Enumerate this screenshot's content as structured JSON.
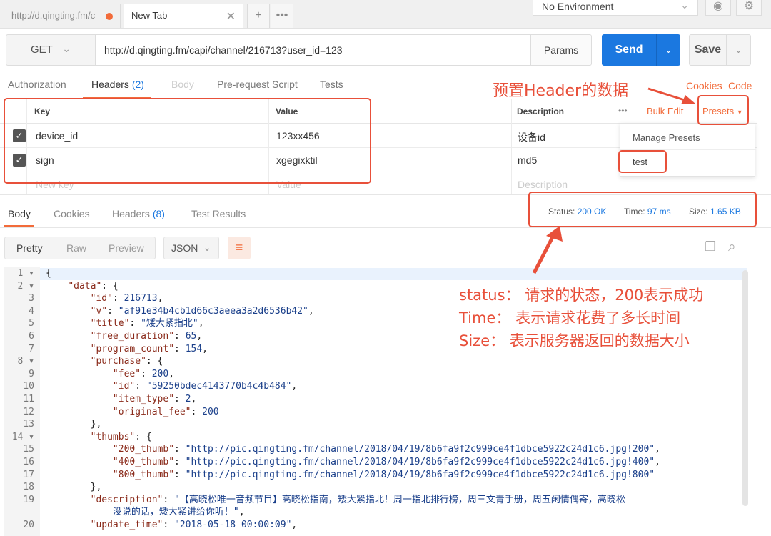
{
  "tabs": [
    {
      "label": "http://d.qingting.fm/c",
      "unsaved": true
    },
    {
      "label": "New Tab"
    }
  ],
  "environment": {
    "selected": "No Environment"
  },
  "request": {
    "method": "GET",
    "url": "http://d.qingting.fm/capi/channel/216713?user_id=123",
    "params_label": "Params",
    "send_label": "Send",
    "save_label": "Save"
  },
  "request_tabs": [
    {
      "label": "Authorization"
    },
    {
      "label": "Headers",
      "count": "(2)"
    },
    {
      "label": "Body"
    },
    {
      "label": "Pre-request Script"
    },
    {
      "label": "Tests"
    }
  ],
  "request_links": {
    "cookies": "Cookies",
    "code": "Code"
  },
  "headers_table": {
    "columns": [
      "Key",
      "Value",
      "Description"
    ],
    "more": "•••",
    "bulk_edit": "Bulk Edit",
    "presets": "Presets",
    "rows": [
      {
        "key": "device_id",
        "value": "123xx456",
        "description": "设备id"
      },
      {
        "key": "sign",
        "value": "xgegixktil",
        "description": "md5"
      }
    ],
    "new_row": {
      "key": "New key",
      "value": "Value",
      "description": "Description"
    }
  },
  "presets_menu": {
    "manage": "Manage Presets",
    "items": [
      "test"
    ]
  },
  "response_tabs": [
    {
      "label": "Body"
    },
    {
      "label": "Cookies"
    },
    {
      "label": "Headers",
      "count": "(8)"
    },
    {
      "label": "Test Results"
    }
  ],
  "response_status": {
    "status_label": "Status:",
    "status_value": "200 OK",
    "time_label": "Time:",
    "time_value": "97 ms",
    "size_label": "Size:",
    "size_value": "1.65 KB"
  },
  "body_view": {
    "modes": [
      "Pretty",
      "Raw",
      "Preview"
    ],
    "format": "JSON"
  },
  "code_lines": [
    {
      "n": "1",
      "fold": true,
      "html": "{"
    },
    {
      "n": "2",
      "fold": true,
      "html": "    <span class=\"k\">\"data\"</span>: {"
    },
    {
      "n": "3",
      "html": "        <span class=\"k\">\"id\"</span>: <span class=\"n\">216713</span>,"
    },
    {
      "n": "4",
      "html": "        <span class=\"k\">\"v\"</span>: <span class=\"s\">\"af91e34b4cb1d66c3aeea3a2d6536b42\"</span>,"
    },
    {
      "n": "5",
      "html": "        <span class=\"k\">\"title\"</span>: <span class=\"s\">\"矮大紧指北\"</span>,"
    },
    {
      "n": "6",
      "html": "        <span class=\"k\">\"free_duration\"</span>: <span class=\"n\">65</span>,"
    },
    {
      "n": "7",
      "html": "        <span class=\"k\">\"program_count\"</span>: <span class=\"n\">154</span>,"
    },
    {
      "n": "8",
      "fold": true,
      "html": "        <span class=\"k\">\"purchase\"</span>: {"
    },
    {
      "n": "9",
      "html": "            <span class=\"k\">\"fee\"</span>: <span class=\"n\">200</span>,"
    },
    {
      "n": "10",
      "html": "            <span class=\"k\">\"id\"</span>: <span class=\"s\">\"59250bdec4143770b4c4b484\"</span>,"
    },
    {
      "n": "11",
      "html": "            <span class=\"k\">\"item_type\"</span>: <span class=\"n\">2</span>,"
    },
    {
      "n": "12",
      "html": "            <span class=\"k\">\"original_fee\"</span>: <span class=\"n\">200</span>"
    },
    {
      "n": "13",
      "html": "        },"
    },
    {
      "n": "14",
      "fold": true,
      "html": "        <span class=\"k\">\"thumbs\"</span>: {"
    },
    {
      "n": "15",
      "html": "            <span class=\"k\">\"200_thumb\"</span>: <span class=\"s\">\"http://pic.qingting.fm/channel/2018/04/19/8b6fa9f2c999ce4f1dbce5922c24d1c6.jpg!200\"</span>,"
    },
    {
      "n": "16",
      "html": "            <span class=\"k\">\"400_thumb\"</span>: <span class=\"s\">\"http://pic.qingting.fm/channel/2018/04/19/8b6fa9f2c999ce4f1dbce5922c24d1c6.jpg!400\"</span>,"
    },
    {
      "n": "17",
      "html": "            <span class=\"k\">\"800_thumb\"</span>: <span class=\"s\">\"http://pic.qingting.fm/channel/2018/04/19/8b6fa9f2c999ce4f1dbce5922c24d1c6.jpg!800\"</span>"
    },
    {
      "n": "18",
      "html": "        },"
    },
    {
      "n": "19",
      "html": "        <span class=\"k\">\"description\"</span>: <span class=\"s\">\"【高晓松唯一音频节目】高晓松指南，矮大紧指北！周一指北排行榜，周三文青手册，周五闲情偶寄，高晓松</span>"
    },
    {
      "n": "",
      "html": "            <span class=\"s\">没说的话，矮大紧讲给你听！\"</span>,"
    },
    {
      "n": "20",
      "html": "        <span class=\"k\">\"update_time\"</span>: <span class=\"s\">\"2018-05-18 00:00:09\"</span>,"
    }
  ],
  "annotations": {
    "presets_note": "预置Header的数据",
    "status_note": "status：  请求的状态，200表示成功",
    "time_note": "Time：  表示请求花费了多长时间",
    "size_note": "Size：  表示服务器返回的数据大小"
  },
  "colors": {
    "accent": "#f26b3a",
    "primary": "#1b78e0",
    "annotation": "#e8503a"
  }
}
